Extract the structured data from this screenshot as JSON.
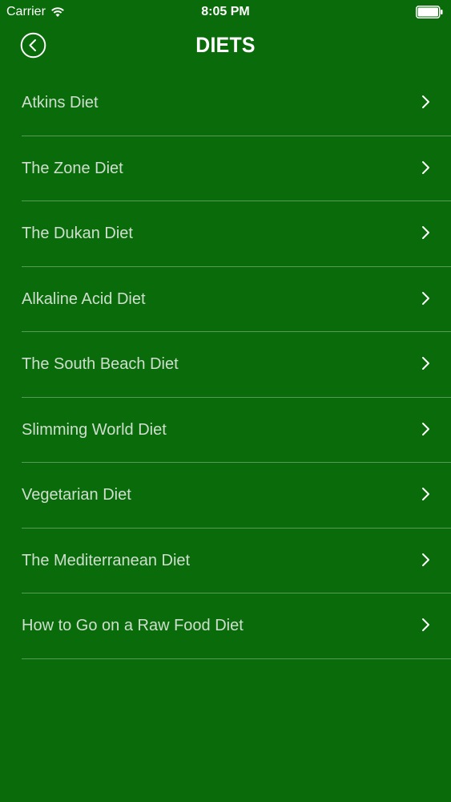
{
  "status_bar": {
    "carrier": "Carrier",
    "time": "8:05 PM",
    "icons": [
      "wifi-icon",
      "battery-icon"
    ]
  },
  "header": {
    "title": "DIETS",
    "back_icon": "circled-chevron-left-icon"
  },
  "list": {
    "items": [
      {
        "label": "Atkins Diet"
      },
      {
        "label": "The Zone Diet"
      },
      {
        "label": "The Dukan Diet"
      },
      {
        "label": "Alkaline Acid Diet"
      },
      {
        "label": "The South Beach Diet"
      },
      {
        "label": "Slimming World Diet"
      },
      {
        "label": "Vegetarian Diet"
      },
      {
        "label": "The Mediterranean Diet"
      },
      {
        "label": "How to Go on a Raw Food Diet"
      }
    ],
    "item_icon": "chevron-right-icon"
  },
  "colors": {
    "background": "#0a6b0a",
    "text": "#ffffff",
    "item_text": "#cfdfcf",
    "divider": "rgba(255,255,255,0.32)"
  }
}
